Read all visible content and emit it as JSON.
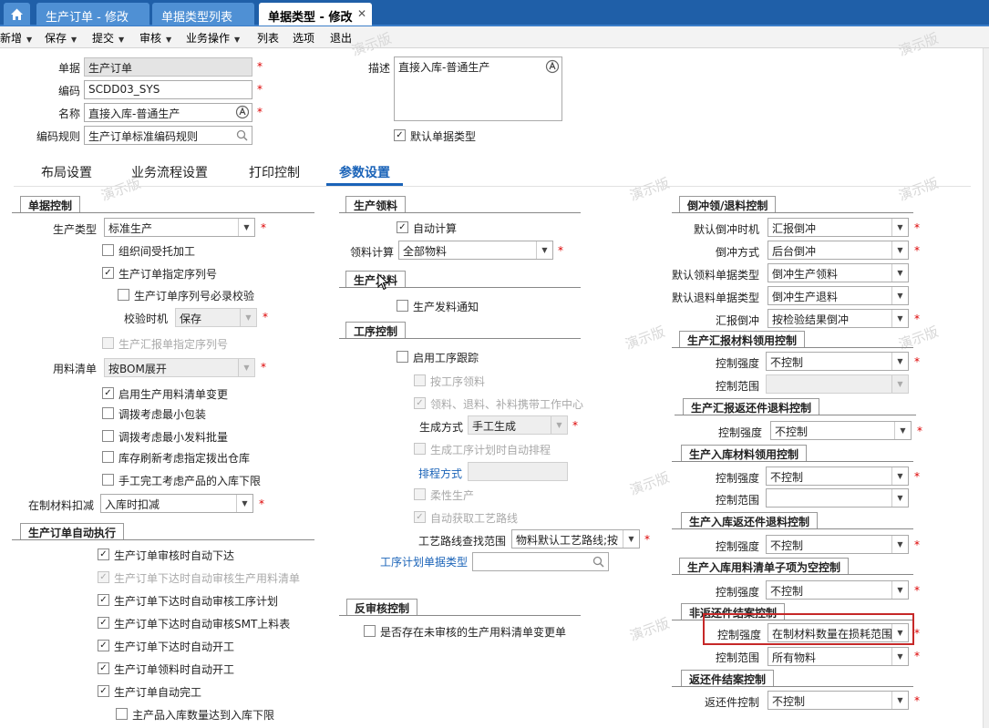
{
  "tabs": [
    {
      "label": "生产订单 - 修改"
    },
    {
      "label": "单据类型列表"
    },
    {
      "label": "单据类型 - 修改"
    }
  ],
  "menu": [
    "新增",
    "保存",
    "提交",
    "审核",
    "业务操作",
    "列表",
    "选项",
    "退出"
  ],
  "header": {
    "bill_label": "单据",
    "bill_value": "生产订单",
    "code_label": "编码",
    "code_value": "SCDD03_SYS",
    "name_label": "名称",
    "name_value": "直接入库-普通生产",
    "rule_label": "编码规则",
    "rule_value": "生产订单标准编码规则",
    "desc_label": "描述",
    "desc_value": "直接入库-普通生产",
    "default_label": "默认单据类型"
  },
  "subtabs": [
    "布局设置",
    "业务流程设置",
    "打印控制",
    "参数设置"
  ],
  "left": {
    "g1_title": "单据控制",
    "prod_type_label": "生产类型",
    "prod_type_value": "标准生产",
    "c_org": "组织间受托加工",
    "c_serial": "生产订单指定序列号",
    "c_serial_check": "生产订单序列号必录校验",
    "check_time_label": "校验时机",
    "check_time_value": "保存",
    "c_report_serial": "生产汇报单指定序列号",
    "bom_label": "用料清单",
    "bom_value": "按BOM展开",
    "c_bom_change": "启用生产用料清单变更",
    "c_min_pack": "调拨考虑最小包装",
    "c_min_batch": "调拨考虑最小发料批量",
    "c_refresh": "库存刷新考虑指定拨出仓库",
    "c_manual": "手工完工考虑产品的入库下限",
    "wip_label": "在制材料扣减",
    "wip_value": "入库时扣减",
    "g2_title": "生产订单自动执行",
    "a1": "生产订单审核时自动下达",
    "a2": "生产订单下达时自动审核生产用料清单",
    "a3": "生产订单下达时自动审核工序计划",
    "a4": "生产订单下达时自动审核SMT上料表",
    "a5": "生产订单下达时自动开工",
    "a6": "生产订单领料时自动开工",
    "a7": "生产订单自动完工",
    "a8": "主产品入库数量达到入库下限"
  },
  "middle": {
    "g1_title": "生产领料",
    "auto_calc": "自动计算",
    "pick_label": "领料计算",
    "pick_value": "全部物料",
    "g2_title": "生产发料",
    "issue_notice": "生产发料通知",
    "g3_title": "工序控制",
    "track": "启用工序跟踪",
    "by_op": "按工序领料",
    "wc": "领料、退料、补料携带工作中心",
    "gen_label": "生成方式",
    "gen_value": "手工生成",
    "auto_sched": "生成工序计划时自动排程",
    "sched_link": "排程方式",
    "flex": "柔性生产",
    "route": "自动获取工艺路线",
    "route_label": "工艺路线查找范围",
    "route_value": "物料默认工艺路线;按",
    "plan_link": "工序计划单据类型",
    "g4_title": "反审核控制",
    "reverse": "是否存在未审核的生产用料清单变更单"
  },
  "right": {
    "g1_title": "倒冲领/退料控制",
    "bf_time_label": "默认倒冲时机",
    "bf_time_value": "汇报倒冲",
    "bf_mode_label": "倒冲方式",
    "bf_mode_value": "后台倒冲",
    "pick_type_label": "默认领料单据类型",
    "pick_type_value": "倒冲生产领料",
    "ret_type_label": "默认退料单据类型",
    "ret_type_value": "倒冲生产退料",
    "rpt_bf_label": "汇报倒冲",
    "rpt_bf_value": "按检验结果倒冲",
    "g2_title": "生产汇报材料领用控制",
    "g2_strength_label": "控制强度",
    "g2_strength_value": "不控制",
    "g2_range_label": "控制范围",
    "g3_title": "生产汇报返还件退料控制",
    "g3_strength_label": "控制强度",
    "g3_strength_value": "不控制",
    "g4_title": "生产入库材料领用控制",
    "g4_strength_label": "控制强度",
    "g4_strength_value": "不控制",
    "g4_range_label": "控制范围",
    "g5_title": "生产入库返还件退料控制",
    "g5_strength_label": "控制强度",
    "g5_strength_value": "不控制",
    "g6_title": "生产入库用料清单子项为空控制",
    "g6_strength_label": "控制强度",
    "g6_strength_value": "不控制",
    "g7_title": "非返还件结案控制",
    "g7_strength_label": "控制强度",
    "g7_strength_value": "在制材料数量在损耗范围",
    "g7_range_label": "控制范围",
    "g7_range_value": "所有物料",
    "g8_title": "返还件结案控制",
    "g8_ctrl_label": "返还件控制",
    "g8_ctrl_value": "不控制"
  },
  "watermark": "演示版",
  "colors": {
    "tab_bar": "#1f5fa8",
    "link": "#1a63b8",
    "highlight": "#c62828",
    "required": "#dd0000"
  }
}
